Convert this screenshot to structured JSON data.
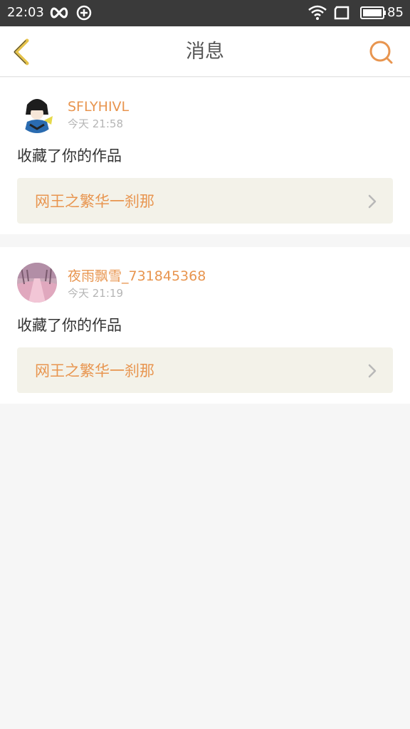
{
  "status_bar": {
    "time": "22:03",
    "battery_level": "85"
  },
  "header": {
    "title": "消息",
    "back_icon": "chevron-left-icon",
    "search_icon": "search-icon"
  },
  "colors": {
    "accent": "#e8954f",
    "back_icon": "#e6c34a",
    "card_bg": "#ffffff",
    "work_box_bg": "#f3f2e9",
    "page_bg": "#f6f6f6"
  },
  "messages": [
    {
      "username": "SFLYHIVL",
      "time": "今天 21:58",
      "action": "收藏了你的作品",
      "work_title": "网王之繁华一刹那"
    },
    {
      "username": "夜雨飘雪_731845368",
      "time": "今天 21:19",
      "action": "收藏了你的作品",
      "work_title": "网王之繁华一刹那"
    }
  ]
}
